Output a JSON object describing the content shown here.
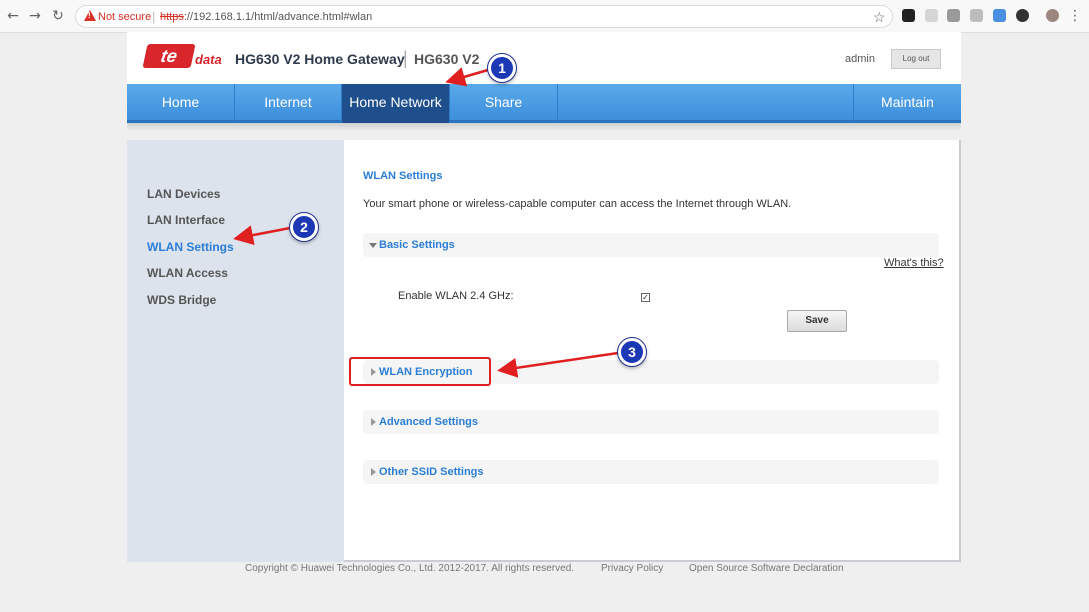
{
  "browser": {
    "not_secure": "Not secure",
    "url_scheme": "https",
    "url_rest": "://192.168.1.1/html/advance.html#wlan"
  },
  "header": {
    "logo_text": "te",
    "logo_sub": "data",
    "product_name": "HG630 V2 Home Gateway",
    "model": "HG630 V2",
    "username": "admin",
    "logout_label": "Log out"
  },
  "menu": {
    "tabs": [
      {
        "label": "Home"
      },
      {
        "label": "Internet"
      },
      {
        "label": "Home Network"
      },
      {
        "label": "Share"
      },
      {
        "label": "Maintain"
      }
    ]
  },
  "sidebar": {
    "items": [
      {
        "label": "LAN Devices"
      },
      {
        "label": "LAN Interface"
      },
      {
        "label": "WLAN Settings"
      },
      {
        "label": "WLAN Access"
      },
      {
        "label": "WDS Bridge"
      }
    ]
  },
  "content": {
    "title": "WLAN Settings",
    "description": "Your smart phone or wireless-capable computer can access the Internet through WLAN.",
    "whats_this": "What's this?",
    "enable_label": "Enable WLAN 2.4 GHz:",
    "enable_checked": true,
    "save_label": "Save",
    "sections": [
      {
        "label": "Basic Settings"
      },
      {
        "label": "WLAN Encryption"
      },
      {
        "label": "Advanced Settings"
      },
      {
        "label": "Other SSID Settings"
      }
    ]
  },
  "footer": {
    "copyright": "Copyright © Huawei Technologies Co., Ltd. 2012-2017. All rights reserved.",
    "privacy": "Privacy Policy",
    "oss": "Open Source Software Declaration"
  },
  "annotations": {
    "step1": "1",
    "step2": "2",
    "step3": "3"
  },
  "colors": {
    "accent": "#2a7ed8",
    "menu_active": "#1e4f8c",
    "annotation_red": "#e02020",
    "annotation_blue": "#1d38b5"
  }
}
